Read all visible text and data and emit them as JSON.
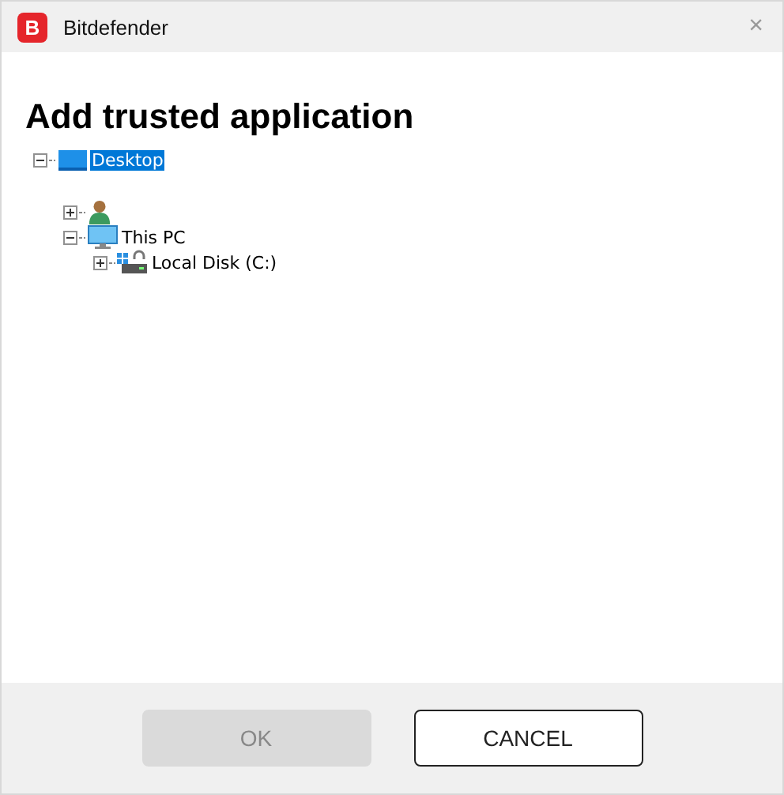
{
  "window": {
    "title": "Bitdefender",
    "logo": "B",
    "close": "×"
  },
  "heading": "Add trusted application",
  "tree": [
    {
      "kind": "desktop",
      "label": "Desktop",
      "expanded": true,
      "selected": true,
      "children": [
        {
          "kind": "user",
          "expanded": false,
          "selected": false
        },
        {
          "kind": "pc",
          "label": "This PC",
          "expanded": true,
          "selected": false,
          "children": [
            {
              "kind": "disk",
              "label": "Local Disk (C:)",
              "expanded": false,
              "selected": false
            }
          ]
        }
      ]
    }
  ],
  "buttons": [
    {
      "label": "OK",
      "disabled": true
    },
    {
      "label": "CANCEL",
      "disabled": false
    }
  ]
}
